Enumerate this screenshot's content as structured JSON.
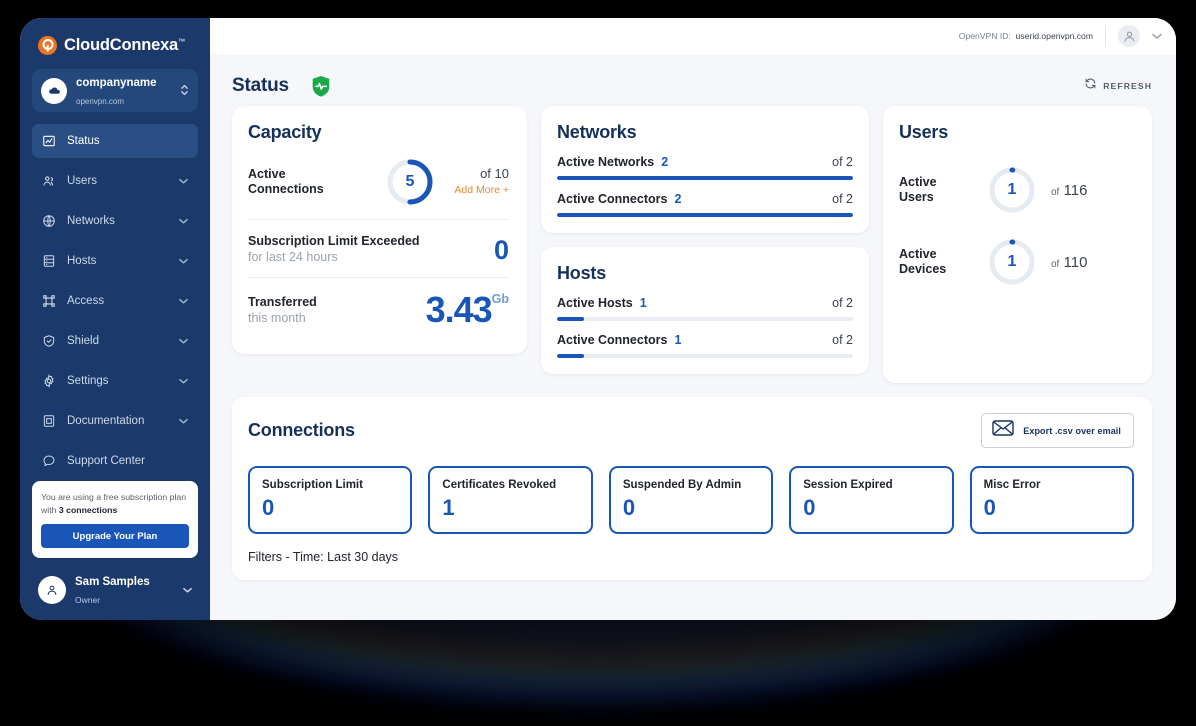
{
  "brand": {
    "name": "CloudConnexa",
    "tm": "™",
    "logo_icon": "openvpn-logo-icon"
  },
  "org": {
    "name": "companyname",
    "domain": "openvpn.com",
    "avatar_icon": "cloud-icon",
    "caret_icon": "chevron-updown-icon"
  },
  "sidebar": {
    "items": [
      {
        "label": "Status",
        "icon": "chart-line-icon",
        "active": true,
        "expandable": false
      },
      {
        "label": "Users",
        "icon": "users-icon",
        "active": false,
        "expandable": true
      },
      {
        "label": "Networks",
        "icon": "globe-icon",
        "active": false,
        "expandable": true
      },
      {
        "label": "Hosts",
        "icon": "server-icon",
        "active": false,
        "expandable": true
      },
      {
        "label": "Access",
        "icon": "crop-frame-icon",
        "active": false,
        "expandable": true
      },
      {
        "label": "Shield",
        "icon": "shield-check-icon",
        "active": false,
        "expandable": true
      },
      {
        "label": "Settings",
        "icon": "gear-icon",
        "active": false,
        "expandable": true
      },
      {
        "label": "Documentation",
        "icon": "book-icon",
        "active": false,
        "expandable": true
      },
      {
        "label": "Support Center",
        "icon": "chat-bubble-icon",
        "active": false,
        "expandable": false
      }
    ],
    "upsell": {
      "text_lead": "You are using a free subscription plan with ",
      "text_bold": "3 connections",
      "button_label": "Upgrade Your Plan"
    },
    "profile": {
      "name": "Sam Samples",
      "role": "Owner",
      "avatar_icon": "person-icon",
      "caret_icon": "chevron-down-icon"
    }
  },
  "topbar": {
    "openvpn_id_label": "OpenVPN ID:",
    "openvpn_id_value": "userid.openvpn.com",
    "account_icon": "person-circle-icon",
    "caret_icon": "chevron-down-icon"
  },
  "header": {
    "title": "Status",
    "health_icon": "shield-heartbeat-icon",
    "health_color": "#1aa84a",
    "refresh_label": "REFRESH",
    "refresh_icon": "refresh-icon"
  },
  "capacity": {
    "title": "Capacity",
    "active_connections": {
      "label_line1": "Active",
      "label_line2": "Connections",
      "value": "5",
      "of": "of 10",
      "max": 10,
      "percent": 50,
      "add_more": "Add More +"
    },
    "subscription": {
      "label": "Subscription Limit Exceeded",
      "sub": "for last 24 hours",
      "value": "0"
    },
    "transferred": {
      "label": "Transferred",
      "sub": "this month",
      "value": "3.43",
      "unit": "Gb"
    }
  },
  "networks": {
    "title": "Networks",
    "rows": [
      {
        "name": "Active Networks",
        "value": "2",
        "of": "of 2",
        "percent": 100
      },
      {
        "name": "Active Connectors",
        "value": "2",
        "of": "of 2",
        "percent": 100
      }
    ]
  },
  "hosts": {
    "title": "Hosts",
    "rows": [
      {
        "name": "Active Hosts",
        "value": "1",
        "of": "of 2",
        "percent": 9
      },
      {
        "name": "Active Connectors",
        "value": "1",
        "of": "of 2",
        "percent": 9
      }
    ]
  },
  "users": {
    "title": "Users",
    "rows": [
      {
        "label_line1": "Active",
        "label_line2": "Users",
        "value": "1",
        "of_prefix": "of",
        "of_value": "116",
        "percent": 1
      },
      {
        "label_line1": "Active",
        "label_line2": "Devices",
        "value": "1",
        "of_prefix": "of",
        "of_value": "110",
        "percent": 1
      }
    ]
  },
  "connections": {
    "title": "Connections",
    "export_label": "Export .csv over email",
    "export_icon": "envelope-icon",
    "tiles": [
      {
        "label": "Subscription Limit",
        "value": "0"
      },
      {
        "label": "Certificates Revoked",
        "value": "1"
      },
      {
        "label": "Suspended By Admin",
        "value": "0"
      },
      {
        "label": "Session Expired",
        "value": "0"
      },
      {
        "label": "Misc Error",
        "value": "0"
      }
    ],
    "filters": "Filters - Time: Last 30 days"
  },
  "colors": {
    "accent_blue": "#1a56b8",
    "sidebar": "#1b3a6b",
    "title_navy": "#16305c",
    "orange": "#e08a2e",
    "green": "#1aa84a"
  }
}
